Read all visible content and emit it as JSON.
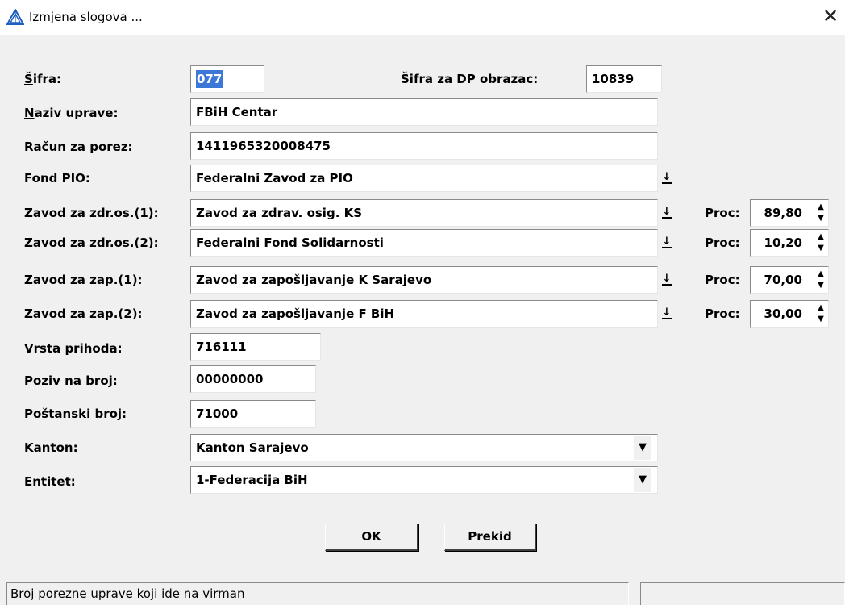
{
  "window": {
    "title": "Izmjena slogova ...",
    "close_glyph": "✕"
  },
  "form": {
    "sifra": {
      "label_ul": "Š",
      "label_rest": "ifra:",
      "value": "077"
    },
    "dp": {
      "label": "Šifra za DP obrazac:",
      "value": "10839"
    },
    "naziv": {
      "label_ul": "N",
      "label_rest": "aziv uprave:",
      "value": "FBiH Centar"
    },
    "racun": {
      "label": "Račun za porez:",
      "value": "1411965320008475"
    },
    "fond_pio": {
      "label": "Fond PIO:",
      "value": "Federalni Zavod za PIO"
    },
    "zdr1": {
      "label": "Zavod za zdr.os.(1):",
      "value": "Zavod za zdrav. osig. KS",
      "proc_label": "Proc:",
      "proc": "89,80"
    },
    "zdr2": {
      "label": "Zavod za zdr.os.(2):",
      "value": "Federalni Fond Solidarnosti",
      "proc_label": "Proc:",
      "proc": "10,20"
    },
    "zap1": {
      "label": "Zavod za zap.(1):",
      "value": "Zavod za zapošljavanje K Sarajevo",
      "proc_label": "Proc:",
      "proc": "70,00"
    },
    "zap2": {
      "label": "Zavod za zap.(2):",
      "value": "Zavod za zapošljavanje F BiH",
      "proc_label": "Proc:",
      "proc": "30,00"
    },
    "vrsta": {
      "label": "Vrsta prihoda:",
      "value": "716111"
    },
    "poziv": {
      "label": "Poziv na broj:",
      "value": "00000000"
    },
    "postanski": {
      "label": "Poštanski broj:",
      "value": "71000"
    },
    "kanton": {
      "label": "Kanton:",
      "value": "Kanton Sarajevo"
    },
    "entitet": {
      "label": "Entitet:",
      "value": " 1-Federacija BiH"
    }
  },
  "buttons": {
    "ok": "OK",
    "cancel": "Prekid"
  },
  "status": {
    "text": "Broj porezne uprave koji ide na virman",
    "right": ""
  },
  "icons": {
    "dropdown": "dropdown-arrow-icon",
    "spinner": "spinner-icon",
    "app": "app-logo-icon"
  }
}
